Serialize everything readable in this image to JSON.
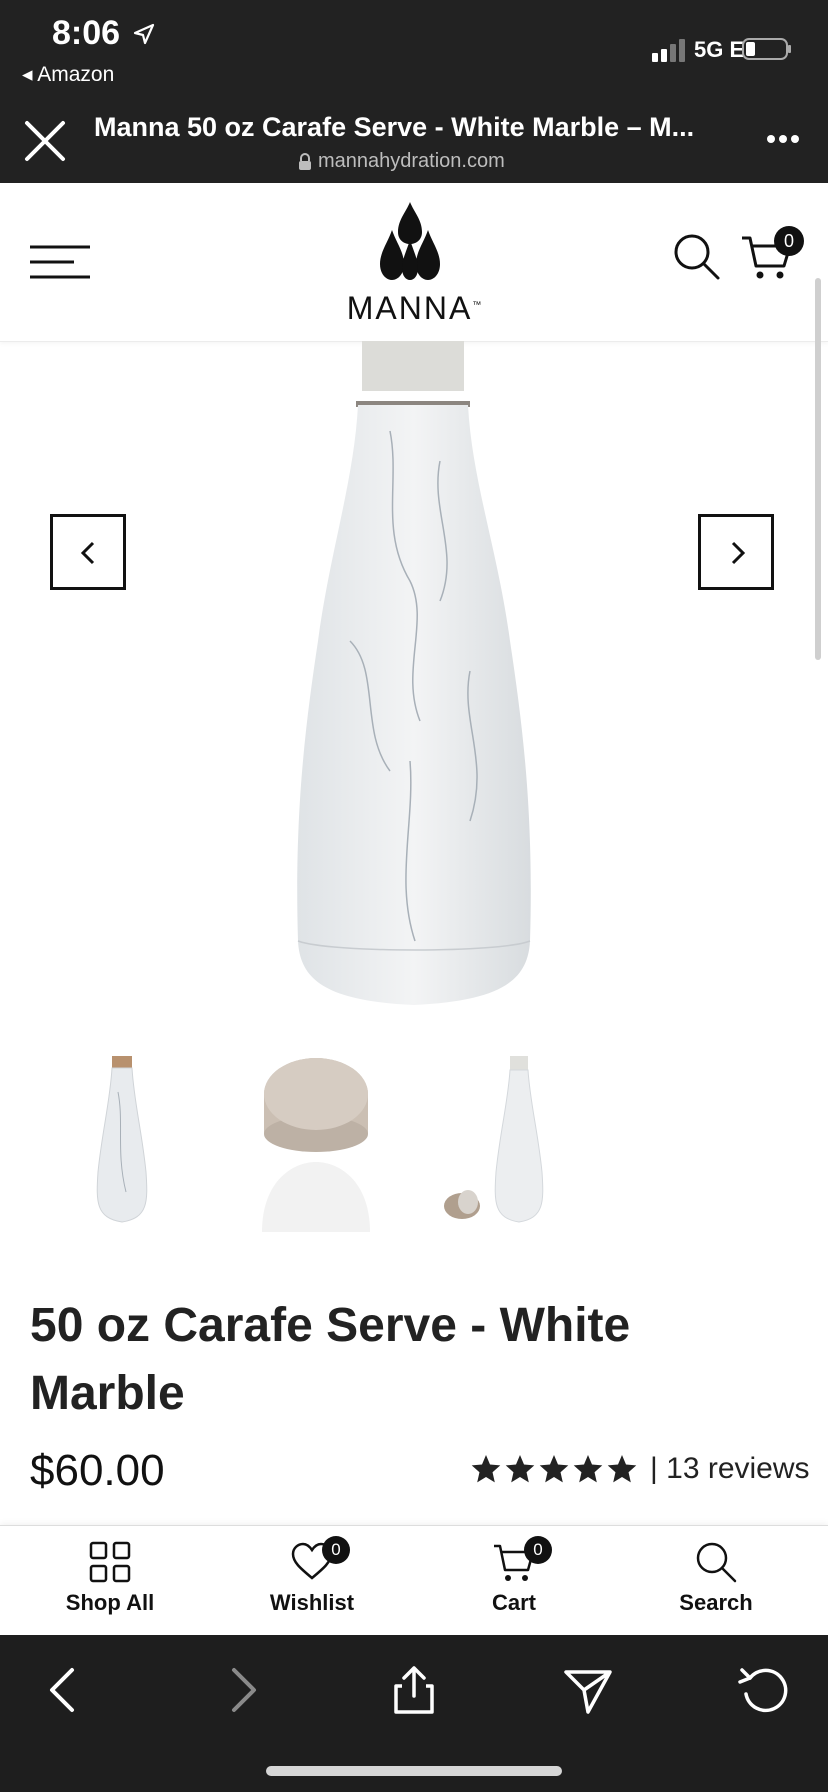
{
  "status_bar": {
    "time": "8:06",
    "back_app": "◂ Amazon",
    "network": "5G E"
  },
  "browser": {
    "page_title": "Manna 50 oz Carafe Serve - White Marble – M...",
    "domain": "mannahydration.com"
  },
  "site_header": {
    "brand": "MANNA",
    "trademark": "™",
    "cart_count": "0"
  },
  "product": {
    "title": "50 oz Carafe Serve - White Marble",
    "price": "$60.00",
    "rating_stars": 5,
    "reviews": "| 13 reviews"
  },
  "bottom_nav": {
    "items": [
      {
        "label": "Shop All",
        "icon": "grid-icon"
      },
      {
        "label": "Wishlist",
        "icon": "heart-icon",
        "badge": "0"
      },
      {
        "label": "Cart",
        "icon": "cart-icon",
        "badge": "0"
      },
      {
        "label": "Search",
        "icon": "search-icon"
      }
    ]
  },
  "colors": {
    "chrome_dark": "#222222",
    "toolbar_dark": "#1e1e1e",
    "text_dark": "#111111",
    "badge_black": "#111111"
  }
}
